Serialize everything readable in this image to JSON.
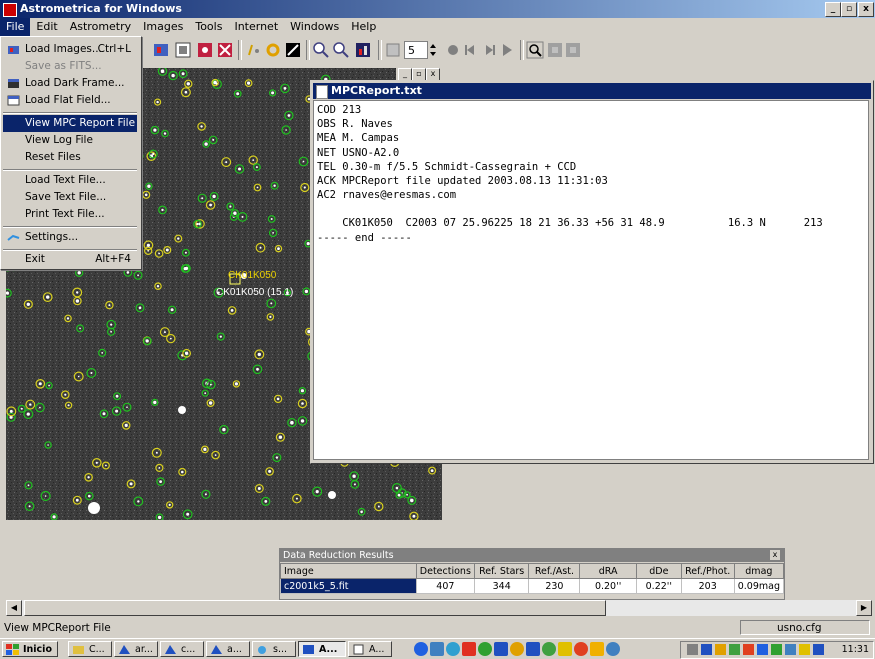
{
  "window": {
    "title": "Astrometrica for Windows",
    "minimize": "_",
    "restore": "▫",
    "close": "x"
  },
  "menubar": [
    "File",
    "Edit",
    "Astrometry",
    "Images",
    "Tools",
    "Internet",
    "Windows",
    "Help"
  ],
  "file_menu": {
    "items": [
      {
        "label": "Load Images...",
        "shortcut": "Ctrl+L",
        "icon": "load-images-icon",
        "disabled": false
      },
      {
        "label": "Save as FITS...",
        "shortcut": "",
        "icon": "",
        "disabled": true
      },
      {
        "label": "Load Dark Frame...",
        "shortcut": "",
        "icon": "load-dark-icon",
        "disabled": false
      },
      {
        "label": "Load Flat Field...",
        "shortcut": "",
        "icon": "load-flat-icon",
        "disabled": false
      },
      {
        "label": "View MPC Report File",
        "shortcut": "",
        "icon": "",
        "disabled": false,
        "highlighted": true
      },
      {
        "label": "View Log File",
        "shortcut": "",
        "icon": "",
        "disabled": false
      },
      {
        "label": "Reset Files",
        "shortcut": "",
        "icon": "",
        "disabled": false
      },
      {
        "label": "Load Text File...",
        "shortcut": "",
        "icon": "",
        "disabled": false
      },
      {
        "label": "Save Text File...",
        "shortcut": "",
        "icon": "",
        "disabled": false
      },
      {
        "label": "Print Text File...",
        "shortcut": "",
        "icon": "",
        "disabled": false
      },
      {
        "label": "Settings...",
        "shortcut": "",
        "icon": "settings-icon",
        "disabled": false
      },
      {
        "label": "Exit",
        "shortcut": "Alt+F4",
        "icon": "",
        "disabled": false
      }
    ]
  },
  "toolbar": {
    "spin_value": "5"
  },
  "image_window": {
    "label_target": "CK01K050",
    "label_measured": "CK01K050 (15.1)",
    "mini_buttons": [
      "_",
      "▫",
      "x"
    ]
  },
  "mpc_window": {
    "title": "MPCReport.txt",
    "lines": [
      "COD 213",
      "OBS R. Naves",
      "MEA M. Campas",
      "NET USNO-A2.0",
      "TEL 0.30-m f/5.5 Schmidt-Cassegrain + CCD",
      "ACK MPCReport file updated 2003.08.13 11:31:03",
      "AC2 rnaves@eresmas.com",
      "",
      "    CK01K050  C2003 07 25.96225 18 21 36.33 +56 31 48.9          16.3 N      213",
      "----- end -----"
    ]
  },
  "data_reduction": {
    "title": "Data Reduction Results",
    "close": "x",
    "headers": [
      "Image",
      "Detections",
      "Ref. Stars",
      "Ref./Ast.",
      "dRA",
      "dDe",
      "Ref./Phot.",
      "dmag"
    ],
    "rows": [
      [
        "c2001k5_5.fit",
        "407",
        "344",
        "230",
        "0.20''",
        "0.22''",
        "203",
        "0.09mag"
      ]
    ]
  },
  "statusbar": {
    "text": "View MPCReport File",
    "config": "usno.cfg"
  },
  "taskbar": {
    "start": "Inicio",
    "buttons": [
      "C...",
      "ar...",
      "c...",
      "a...",
      "s...",
      "A...",
      "A..."
    ],
    "clock": "11:31"
  }
}
